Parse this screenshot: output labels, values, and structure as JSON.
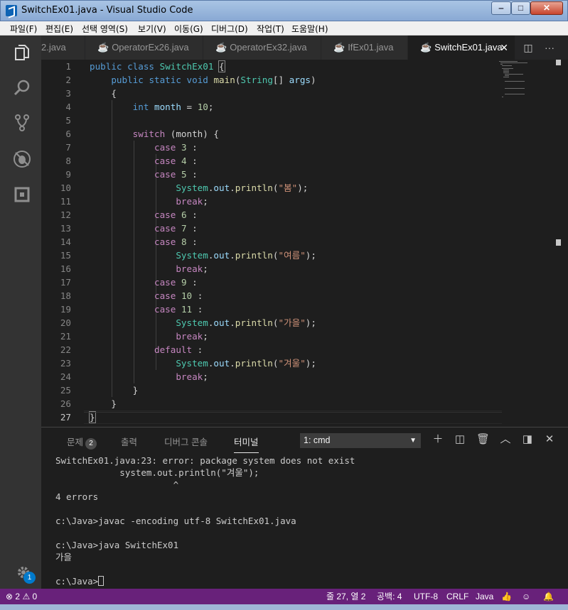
{
  "window": {
    "title": "SwitchEx01.java - Visual Studio Code",
    "min": "‒",
    "max": "□",
    "close": "✕"
  },
  "menu": [
    "파일(F)",
    "편집(E)",
    "선택 영역(S)",
    "보기(V)",
    "이동(G)",
    "디버그(D)",
    "작업(T)",
    "도움말(H)"
  ],
  "tabs": [
    {
      "label": "2.java"
    },
    {
      "label": "OperatorEx26.java"
    },
    {
      "label": "OperatorEx32.java"
    },
    {
      "label": "IfEx01.java"
    },
    {
      "label": "SwitchEx01.java",
      "active": true
    }
  ],
  "tab_close": "✕",
  "tab_more": "···",
  "editor": {
    "current_line": 27,
    "lines": [
      {
        "n": "1"
      },
      {
        "n": "2"
      },
      {
        "n": "3"
      },
      {
        "n": "4"
      },
      {
        "n": "5"
      },
      {
        "n": "6"
      },
      {
        "n": "7"
      },
      {
        "n": "8"
      },
      {
        "n": "9"
      },
      {
        "n": "10"
      },
      {
        "n": "11"
      },
      {
        "n": "12"
      },
      {
        "n": "13"
      },
      {
        "n": "14"
      },
      {
        "n": "15"
      },
      {
        "n": "16"
      },
      {
        "n": "17"
      },
      {
        "n": "18"
      },
      {
        "n": "19"
      },
      {
        "n": "20"
      },
      {
        "n": "21"
      },
      {
        "n": "22"
      },
      {
        "n": "23"
      },
      {
        "n": "24"
      },
      {
        "n": "25"
      },
      {
        "n": "26"
      },
      {
        "n": "27"
      }
    ],
    "code": {
      "l1": [
        "public",
        "class",
        "SwitchEx01",
        "{"
      ],
      "l2": [
        "public",
        "static",
        "void",
        "main",
        "(",
        "String",
        "[] ",
        "args",
        ")"
      ],
      "l3": "{",
      "l4": [
        "int",
        "month",
        " = ",
        "10",
        ";"
      ],
      "l6": [
        "switch",
        " (month) {"
      ],
      "case": "case",
      "colon": " :",
      "l7": "3",
      "l8": "4",
      "l9": "5",
      "l12": "6",
      "l13": "7",
      "l14": "8",
      "l17": "9",
      "l18": "10",
      "l19": "11",
      "system": "System",
      "out": "out",
      "println": "println",
      "s10": "\"봄\"",
      "s15": "\"여름\"",
      "s20": "\"가을\"",
      "s24": "\"겨울\"",
      "tail": ");",
      "break": "break",
      "semi": ";",
      "default": "default",
      "l25": "}",
      "l26": "}",
      "l27": "}"
    }
  },
  "panel": {
    "tabs": {
      "problems": "문제",
      "problems_count": "2",
      "output": "출력",
      "debug_console": "디버그 콘솔",
      "terminal": "터미널"
    },
    "terminal_select": "1: cmd",
    "terminal_lines": [
      "SwitchEx01.java:23: error: package system does not exist",
      "            system.out.println(\"겨울\");",
      "                      ^",
      "4 errors",
      "",
      "c:\\Java>javac -encoding utf-8 SwitchEx01.java",
      "",
      "c:\\Java>java SwitchEx01",
      "가을",
      "",
      "c:\\Java>"
    ]
  },
  "status": {
    "errors": "2",
    "warnings": "0",
    "position": "줄 27, 열 2",
    "spaces": "공백: 4",
    "encoding": "UTF-8",
    "eol": "CRLF",
    "language": "Java",
    "gear_badge": "1"
  },
  "colors": {
    "statusbar": "#68217a",
    "accent": "#007acc",
    "editor_bg": "#1e1e1e"
  }
}
